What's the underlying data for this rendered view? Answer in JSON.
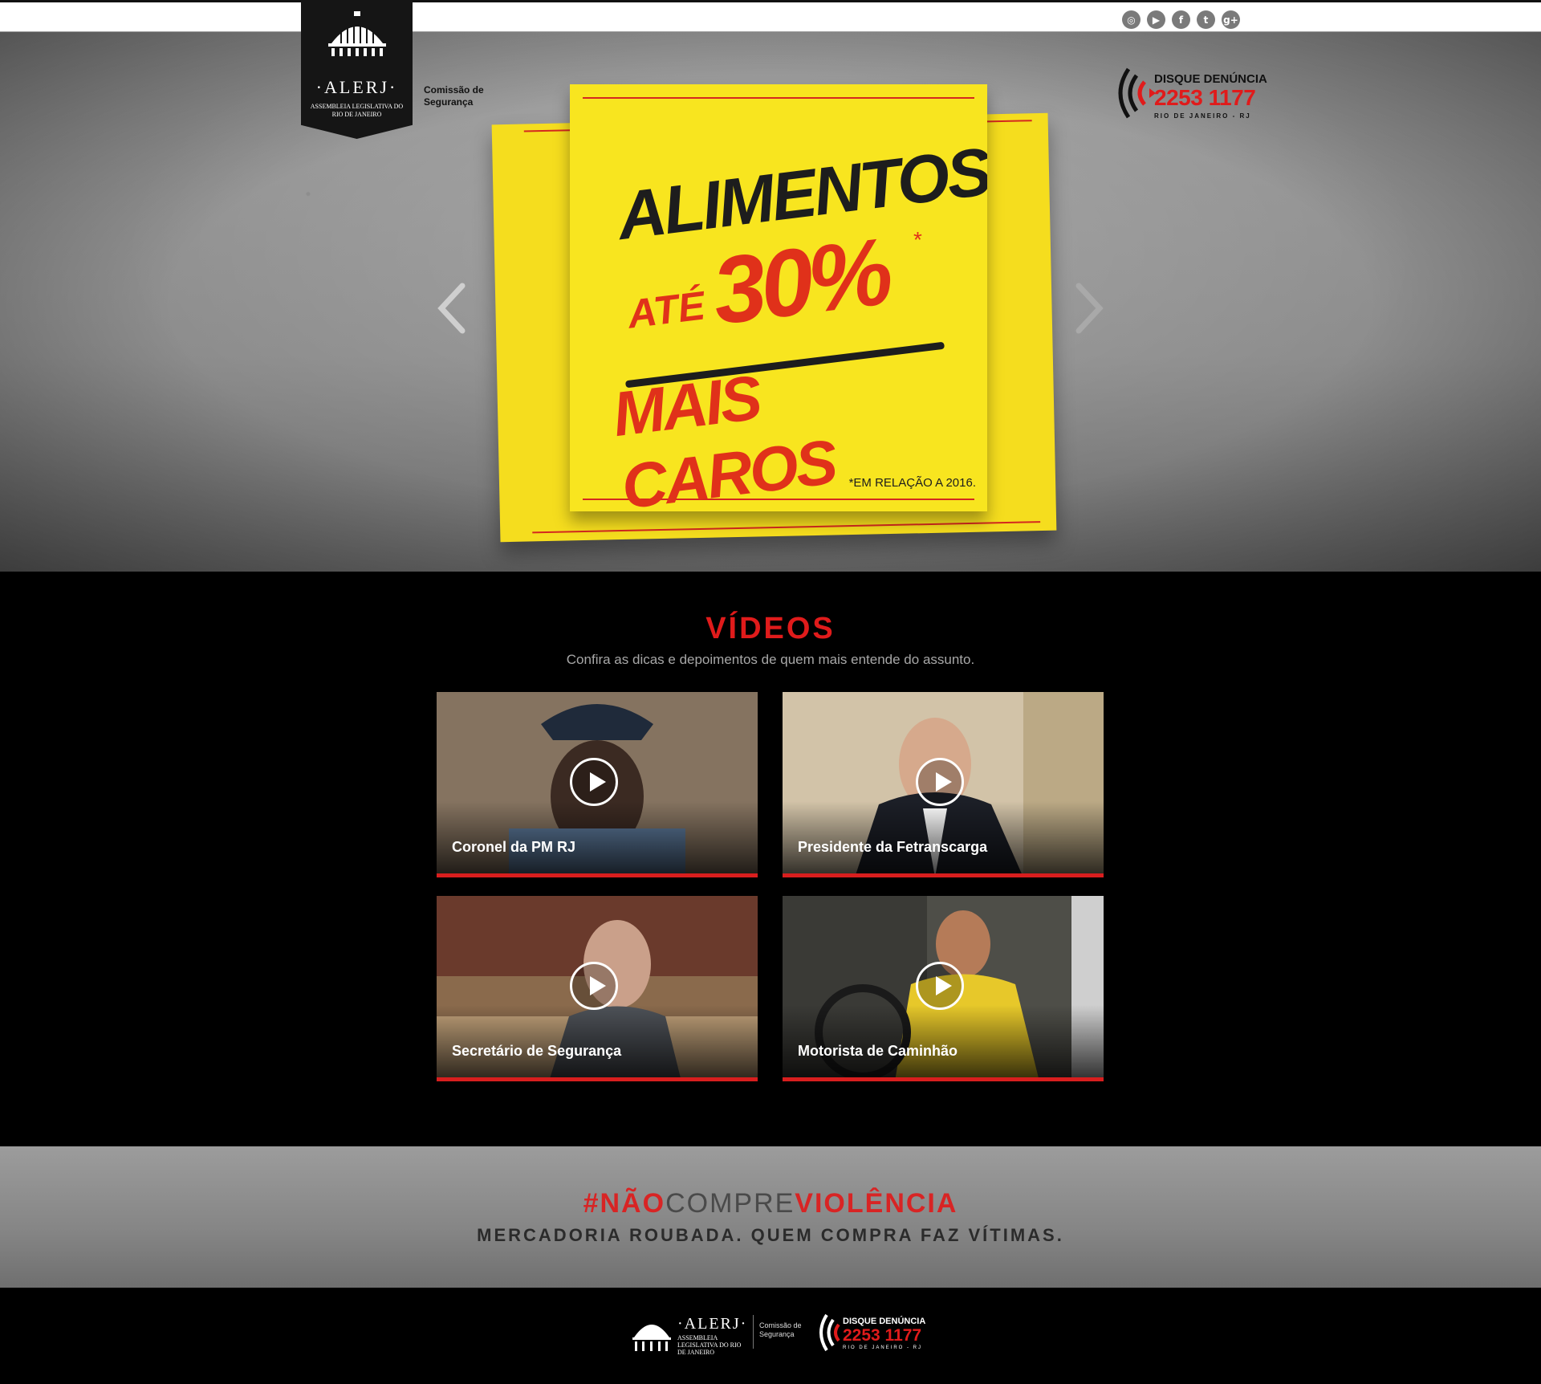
{
  "header": {
    "social": [
      {
        "name": "instagram-icon",
        "glyph": "◎"
      },
      {
        "name": "youtube-icon",
        "glyph": "▶"
      },
      {
        "name": "facebook-icon",
        "glyph": "f"
      },
      {
        "name": "twitter-icon",
        "glyph": "t"
      },
      {
        "name": "google-plus-icon",
        "glyph": "g+"
      }
    ],
    "logo_word": "·ALERJ·",
    "logo_sub": "ASSEMBLEIA LEGISLATIVA DO RIO DE JANEIRO",
    "commission": "Comissão de Segurança",
    "disque": {
      "line1": "DISQUE DENÚNCIA",
      "phone": "2253 1177",
      "region": "RIO DE JANEIRO - RJ"
    }
  },
  "hero": {
    "word1": "ALIMENTOS",
    "ate": "ATÉ",
    "percent": "30%",
    "star": "*",
    "word2": "MAIS CAROS",
    "footnote": "*EM RELAÇÃO A 2016.",
    "prev_icon": "chevron-left-icon",
    "next_icon": "chevron-right-icon"
  },
  "videos": {
    "title": "VÍDEOS",
    "subtitle": "Confira as dicas e depoimentos de quem mais entende do assunto.",
    "items": [
      {
        "label": "Coronel da PM RJ",
        "bg": "#6b5a4a"
      },
      {
        "label": "Presidente da Fetranscarga",
        "bg": "#c9b9a0"
      },
      {
        "label": "Secretário de Segurança",
        "bg": "#8a6a4c"
      },
      {
        "label": "Motorista de Caminhão",
        "bg": "#5a5a52"
      }
    ]
  },
  "campaign": {
    "hash": "#",
    "nao": "NÃO",
    "compre": "COMPRE",
    "violencia": "VIOLÊNCIA",
    "tagline": "MERCADORIA ROUBADA. QUEM COMPRA FAZ VÍTIMAS."
  },
  "footer": {
    "logo_word": "·ALERJ·",
    "logo_sub": "ASSEMBLEIA LEGISLATIVA DO RIO DE JANEIRO",
    "commission": "Comissão de Segurança",
    "disque": {
      "line1": "DISQUE DENÚNCIA",
      "phone": "2253 1177",
      "region": "RIO DE JANEIRO - RJ"
    }
  },
  "colors": {
    "accent_red": "#e01b1b",
    "note_yellow": "#f8e51f"
  }
}
